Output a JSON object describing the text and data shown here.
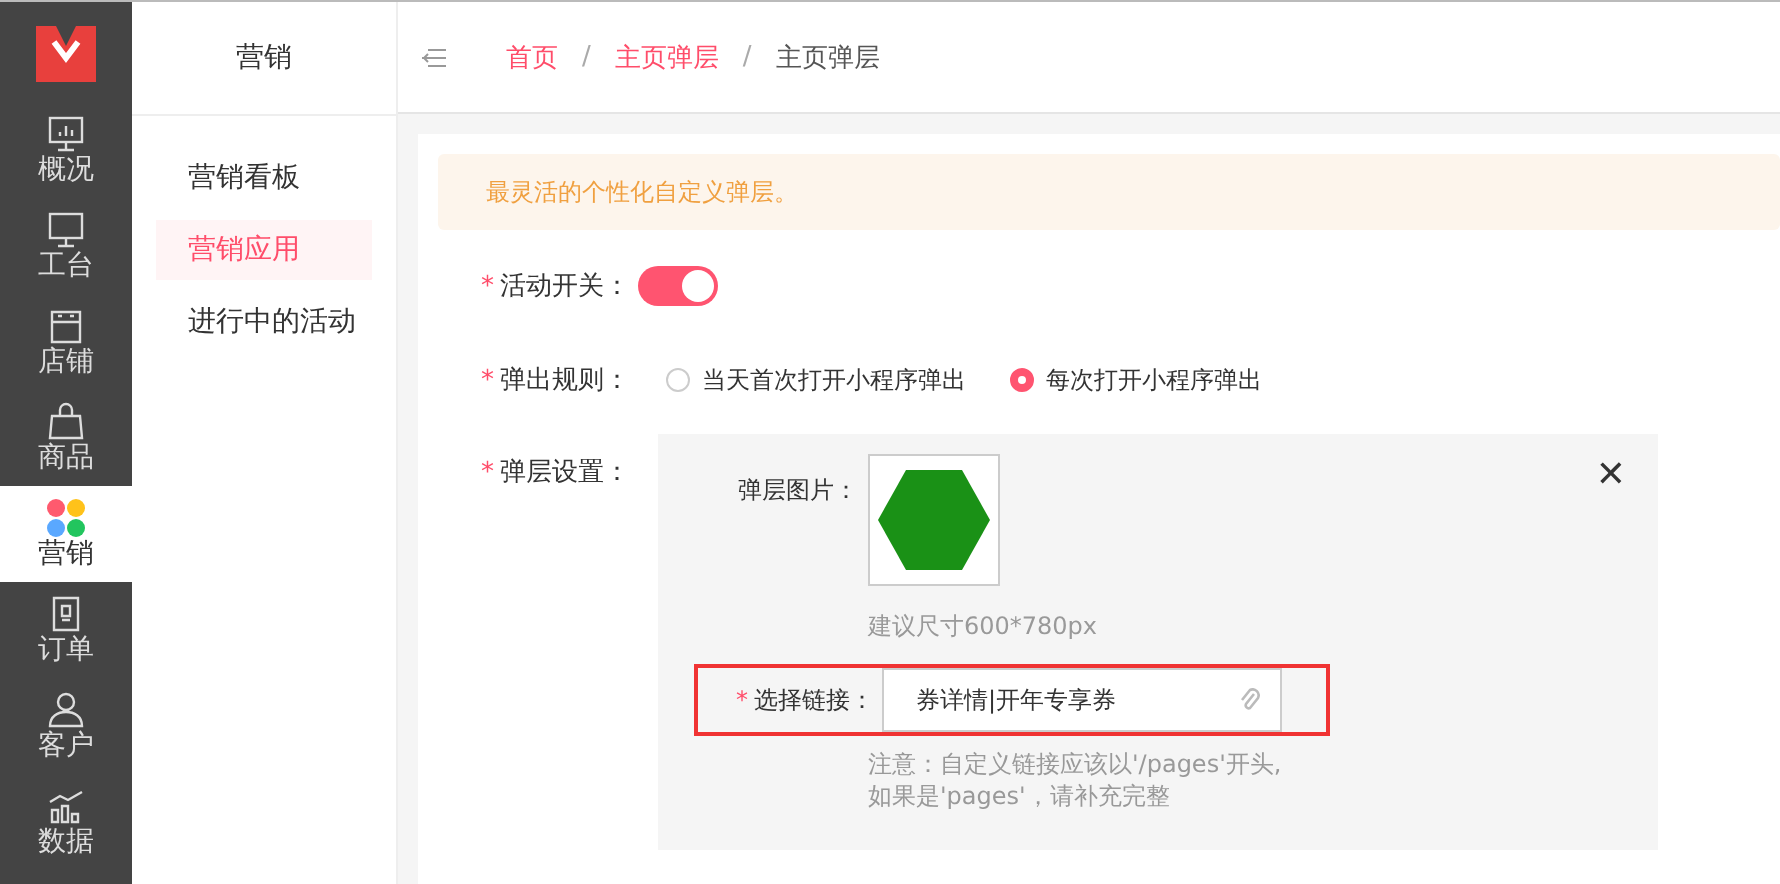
{
  "rail": {
    "items": [
      {
        "label": "概况",
        "selected": false
      },
      {
        "label": "工台",
        "selected": false
      },
      {
        "label": "店铺",
        "selected": false
      },
      {
        "label": "商品",
        "selected": false
      },
      {
        "label": "营销",
        "selected": true
      },
      {
        "label": "订单",
        "selected": false
      },
      {
        "label": "客户",
        "selected": false
      },
      {
        "label": "数据",
        "selected": false
      }
    ]
  },
  "submenu": {
    "title": "营销",
    "items": [
      {
        "label": "营销看板",
        "selected": false
      },
      {
        "label": "营销应用",
        "selected": true
      },
      {
        "label": "进行中的活动",
        "selected": false
      }
    ]
  },
  "breadcrumb": [
    {
      "label": "首页",
      "link": true
    },
    {
      "separator": "/",
      "label": "主页弹层",
      "link": true
    },
    {
      "separator": "/",
      "label": "主页弹层",
      "link": false
    }
  ],
  "notice": "最灵活的个性化自定义弹层。",
  "form": {
    "switch": {
      "required_mark": "*",
      "label": "活动开关：",
      "on": true
    },
    "rule": {
      "required_mark": "*",
      "label": "弹出规则：",
      "options": [
        {
          "label": "当天首次打开小程序弹出",
          "selected": false
        },
        {
          "label": "每次打开小程序弹出",
          "selected": true
        }
      ]
    },
    "layer": {
      "required_mark": "*",
      "label": "弹层设置：",
      "close": "✕",
      "image_label": "弹层图片：",
      "image_hint": "建议尺寸600*780px",
      "link": {
        "required_mark": "*",
        "label": "选择链接：",
        "value": "券详情|开年专享券",
        "highlighted": true
      },
      "note": [
        "注意：自定义链接应该以'/pages'开头,",
        "如果是'pages'，请补充完整"
      ]
    }
  }
}
